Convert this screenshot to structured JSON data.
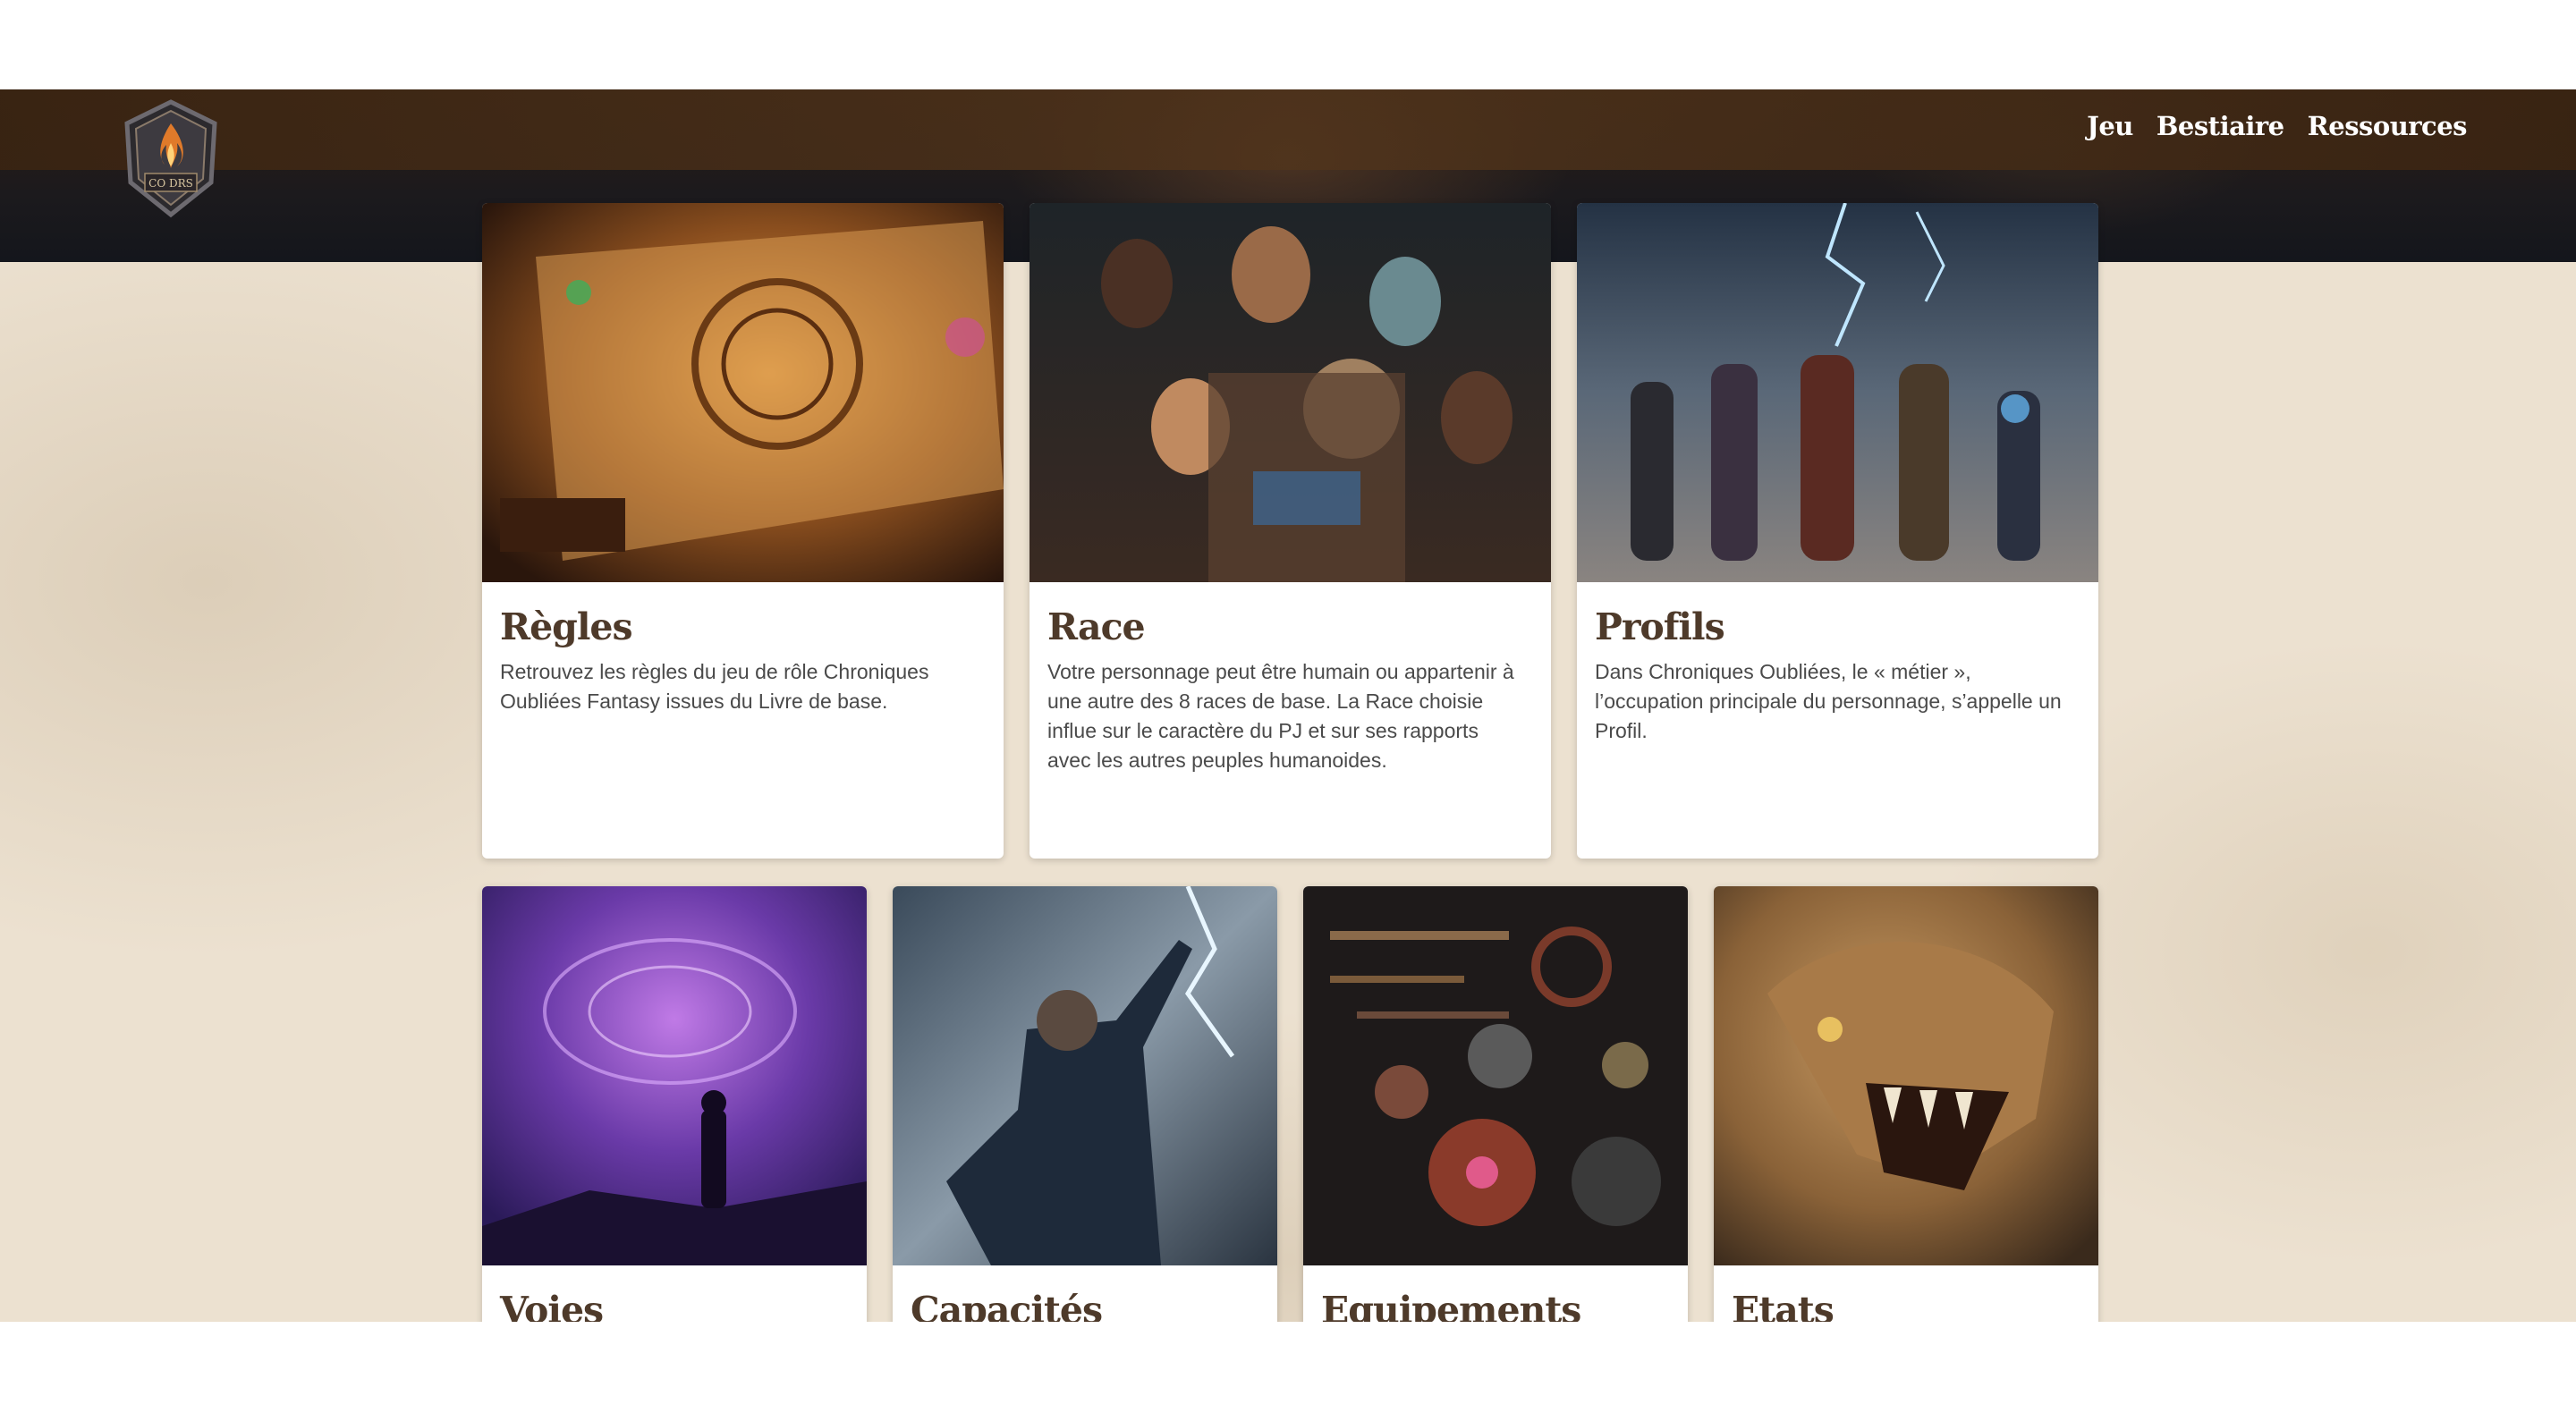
{
  "nav": {
    "logo_text": "CO DRS",
    "links": [
      "Jeu",
      "Bestiaire",
      "Ressources"
    ]
  },
  "cards": [
    {
      "title": "Règles",
      "description": "Retrouvez les règles du jeu de rôle Chroniques Oubliées Fantasy issues du Livre de base."
    },
    {
      "title": "Race",
      "description": "Votre personnage peut être humain ou appartenir à une autre des 8 races de base. La Race choisie influe sur le caractère du PJ et sur ses rapports avec les autres peuples humanoides."
    },
    {
      "title": "Profils",
      "description": "Dans Chroniques Oubliées, le « métier », l’occupation principale du personnage, s’appelle un Profil."
    },
    {
      "title": "Voies"
    },
    {
      "title": "Capacités"
    },
    {
      "title": "Equipements"
    },
    {
      "title": "Etats préjudiciables"
    }
  ],
  "colors": {
    "navbar": "#3a2412",
    "page_bg": "#ece1d0",
    "card_title": "#4e3a2a",
    "card_text": "#4a4a4a"
  }
}
